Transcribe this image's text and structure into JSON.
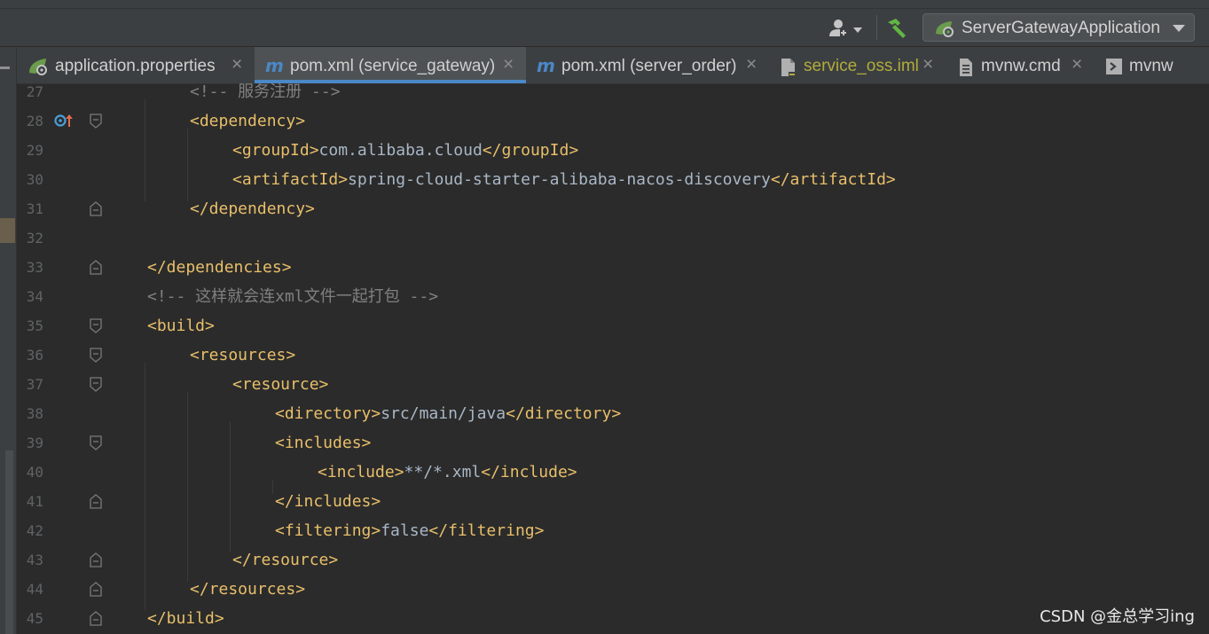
{
  "toolbar": {
    "run_config": "ServerGatewayApplication"
  },
  "tabs": [
    {
      "label": "application.properties",
      "icon": "spring-leaf-icon",
      "active": false
    },
    {
      "label": "pom.xml (service_gateway)",
      "icon": "maven-icon",
      "active": true
    },
    {
      "label": "pom.xml (server_order)",
      "icon": "maven-icon",
      "active": false
    },
    {
      "label": "service_oss.iml",
      "icon": "module-file-icon",
      "active": false,
      "color": "#b1ab3c"
    },
    {
      "label": "mvnw.cmd",
      "icon": "text-file-icon",
      "active": false
    },
    {
      "label": "mvnw",
      "icon": "shell-file-icon",
      "active": false
    }
  ],
  "editor": {
    "line_numbers": [
      "27",
      "28",
      "29",
      "30",
      "31",
      "32",
      "33",
      "34",
      "35",
      "36",
      "37",
      "38",
      "39",
      "40",
      "41",
      "42",
      "43",
      "44",
      "45"
    ],
    "lines": [
      [
        {
          "t": "<!-- 服务注册 -->",
          "c": "comment"
        }
      ],
      [
        {
          "t": "<dependency>",
          "c": "tag"
        }
      ],
      [
        {
          "t": "<groupId>",
          "c": "tag"
        },
        {
          "t": "com.alibaba.cloud",
          "c": "text"
        },
        {
          "t": "</groupId>",
          "c": "tag"
        }
      ],
      [
        {
          "t": "<artifactId>",
          "c": "tag"
        },
        {
          "t": "spring-cloud-starter-alibaba-nacos-discovery",
          "c": "text"
        },
        {
          "t": "</artifactId>",
          "c": "tag"
        }
      ],
      [
        {
          "t": "</dependency>",
          "c": "tag"
        }
      ],
      [],
      [
        {
          "t": "</dependencies>",
          "c": "tag"
        }
      ],
      [
        {
          "t": "<!-- 这样就会连xml文件一起打包 -->",
          "c": "comment"
        }
      ],
      [
        {
          "t": "<build>",
          "c": "tag"
        }
      ],
      [
        {
          "t": "<resources>",
          "c": "tag"
        }
      ],
      [
        {
          "t": "<resource>",
          "c": "tag"
        }
      ],
      [
        {
          "t": "<directory>",
          "c": "tag"
        },
        {
          "t": "src/main/java",
          "c": "text"
        },
        {
          "t": "</directory>",
          "c": "tag"
        }
      ],
      [
        {
          "t": "<includes>",
          "c": "tag"
        }
      ],
      [
        {
          "t": "<include>",
          "c": "tag"
        },
        {
          "t": "**/*.xml",
          "c": "text"
        },
        {
          "t": "</include>",
          "c": "tag"
        }
      ],
      [
        {
          "t": "</includes>",
          "c": "tag"
        }
      ],
      [
        {
          "t": "<filtering>",
          "c": "tag"
        },
        {
          "t": "false",
          "c": "text"
        },
        {
          "t": "</filtering>",
          "c": "tag"
        }
      ],
      [
        {
          "t": "</resource>",
          "c": "tag"
        }
      ],
      [
        {
          "t": "</resources>",
          "c": "tag"
        }
      ],
      [
        {
          "t": "</build>",
          "c": "tag"
        }
      ]
    ]
  },
  "watermark": "CSDN @金总学习ing",
  "colors": {
    "tag": "#e8bf6a",
    "text": "#a9b7c6",
    "comment": "#808080",
    "gutter": "#606366",
    "accent": "#4a88c7"
  }
}
